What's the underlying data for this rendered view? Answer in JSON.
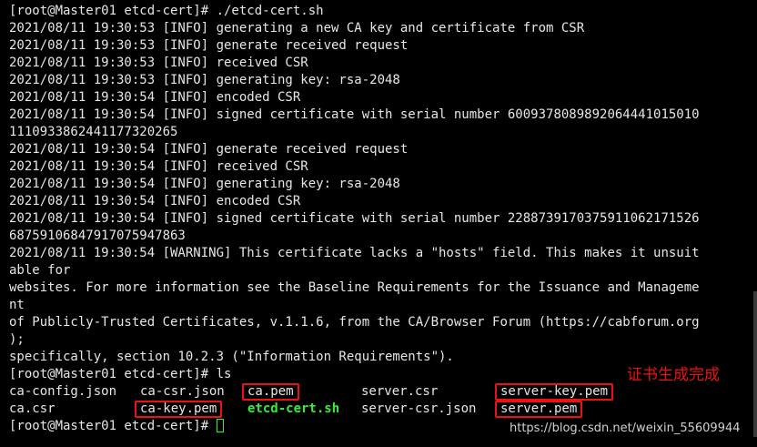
{
  "terminal": {
    "lines": [
      "[root@Master01 etcd-cert]# ./etcd-cert.sh",
      "2021/08/11 19:30:53 [INFO] generating a new CA key and certificate from CSR",
      "2021/08/11 19:30:53 [INFO] generate received request",
      "2021/08/11 19:30:53 [INFO] received CSR",
      "2021/08/11 19:30:53 [INFO] generating key: rsa-2048",
      "2021/08/11 19:30:54 [INFO] encoded CSR",
      "2021/08/11 19:30:54 [INFO] signed certificate with serial number 6009378089892064441015010",
      "1110933862441177320265",
      "2021/08/11 19:30:54 [INFO] generate received request",
      "2021/08/11 19:30:54 [INFO] received CSR",
      "2021/08/11 19:30:54 [INFO] generating key: rsa-2048",
      "2021/08/11 19:30:54 [INFO] encoded CSR",
      "2021/08/11 19:30:54 [INFO] signed certificate with serial number 2288739170375911062171526",
      "6875910684791707594786З",
      "2021/08/11 19:30:54 [WARNING] This certificate lacks a \"hosts\" field. This makes it unsuit",
      "able for",
      "websites. For more information see the Baseline Requirements for the Issuance and Manageme",
      "nt",
      "of Publicly-Trusted Certificates, v.1.1.6, from the CA/Browser Forum (https://cabforum.org",
      ");",
      "specifically, section 10.2.3 (\"Information Requirements\").",
      "[root@Master01 etcd-cert]# ls"
    ],
    "ls_row1": {
      "col1": "ca-config.json",
      "col2": "ca-csr.json",
      "col3": "ca.pem",
      "col4": "server.csr",
      "col5": "server-key.pem"
    },
    "ls_row2": {
      "col1": "ca.csr",
      "col2": "ca-key.pem",
      "col3": "etcd-cert.sh",
      "col4": "server-csr.json",
      "col5": "server.pem"
    },
    "prompt": "[root@Master01 etcd-cert]# "
  },
  "annotation": "证书生成完成",
  "watermark": "https://blog.csdn.net/weixin_55609944",
  "colors": {
    "background": "#000000",
    "text": "#e6e6e6",
    "executable": "#33ee33",
    "highlight": "#ee1111"
  }
}
